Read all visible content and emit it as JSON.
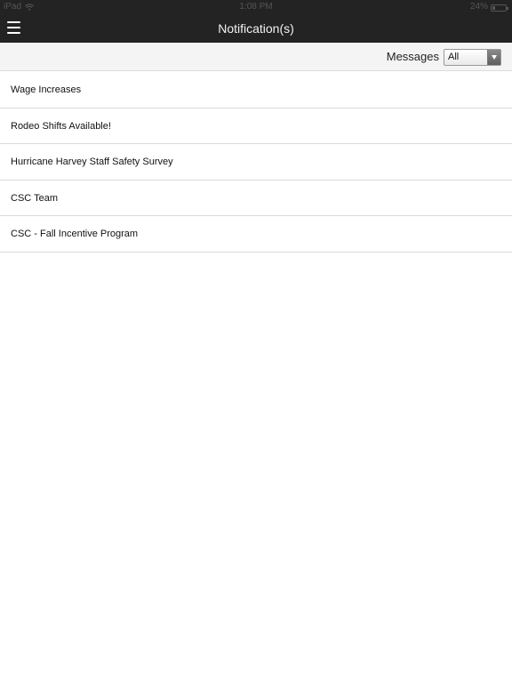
{
  "status_bar": {
    "device": "iPad",
    "time": "1:08 PM",
    "battery": "24%",
    "battery_level": 0.24
  },
  "nav": {
    "title": "Notification(s)"
  },
  "filter": {
    "label": "Messages",
    "selected": "All"
  },
  "messages": [
    {
      "title": "Wage Increases"
    },
    {
      "title": "Rodeo Shifts Available!"
    },
    {
      "title": "Hurricane Harvey Staff Safety Survey"
    },
    {
      "title": "CSC Team"
    },
    {
      "title": "CSC - Fall Incentive Program"
    }
  ]
}
